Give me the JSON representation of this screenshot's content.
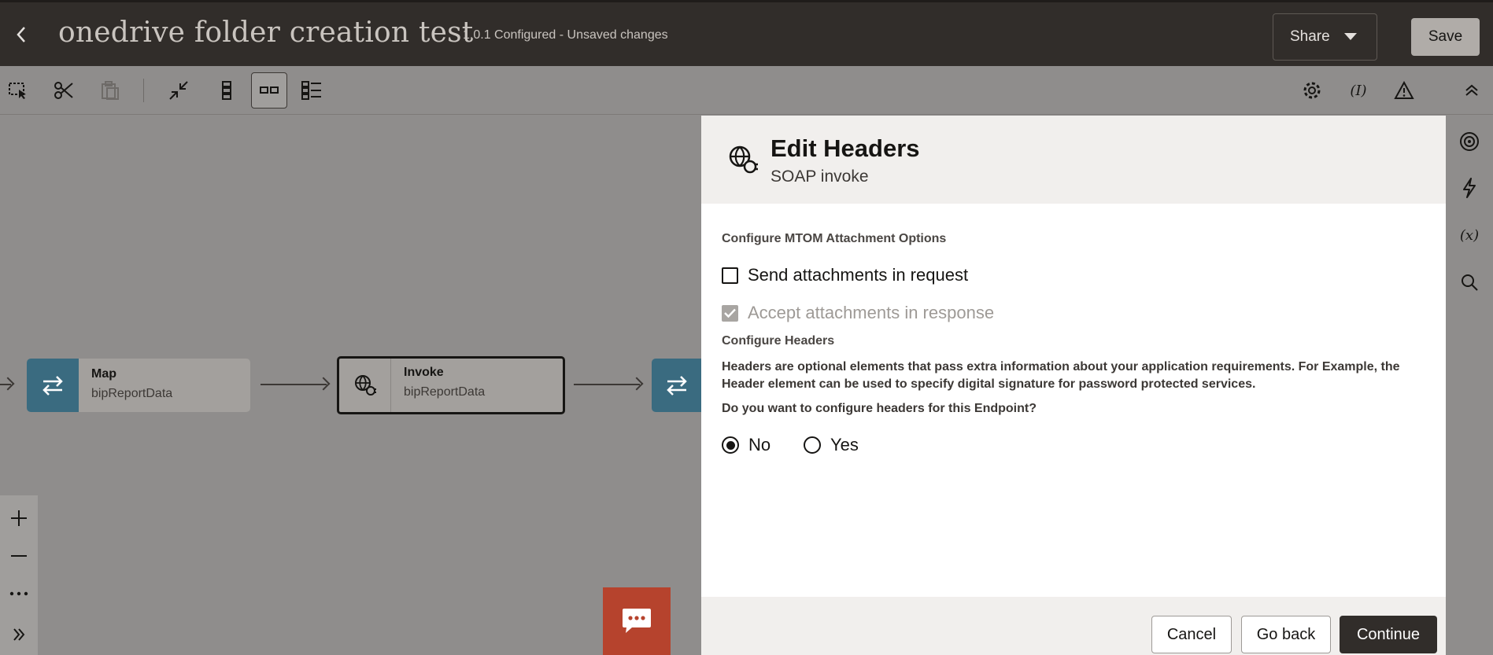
{
  "header": {
    "title": "onedrive folder creation test",
    "version_status": "1.0.1 Configured - Unsaved changes",
    "share_label": "Share",
    "save_label": "Save"
  },
  "toolbar": {
    "left_icons": [
      "select-icon",
      "cut-icon",
      "paste-icon",
      "collapse-icon",
      "vertical-layout-icon",
      "horizontal-layout-icon",
      "pseudo-layout-icon"
    ],
    "right_icons": [
      "gear-icon",
      "integration-properties-icon",
      "warning-icon",
      "chevron-up-icon"
    ]
  },
  "canvas": {
    "nodes": [
      {
        "title": "Map",
        "subtitle": "bipReportData",
        "icon": "map-icon"
      },
      {
        "title": "Invoke",
        "subtitle": "bipReportData",
        "icon": "soap-globe-icon"
      }
    ]
  },
  "panel": {
    "title": "Edit Headers",
    "subtitle": "SOAP invoke",
    "mtom_label": "Configure MTOM Attachment Options",
    "send_attachments_label": "Send attachments in request",
    "send_attachments_checked": false,
    "accept_attachments_label": "Accept attachments in response",
    "accept_attachments_checked": true,
    "headers_label": "Configure Headers",
    "headers_description": "Headers are optional elements that pass extra information about your application requirements. For Example, the Header element can be used to specify digital signature for password protected services.",
    "question": "Do you want to configure headers for this Endpoint?",
    "options": [
      {
        "label": "No",
        "selected": true
      },
      {
        "label": "Yes",
        "selected": false
      }
    ],
    "cancel_label": "Cancel",
    "go_back_label": "Go back",
    "continue_label": "Continue"
  },
  "colors": {
    "header_bg": "#312d2a",
    "accent_node": "#3a6b80",
    "primary_button": "#312d2a",
    "chat_button": "#b6432d"
  }
}
